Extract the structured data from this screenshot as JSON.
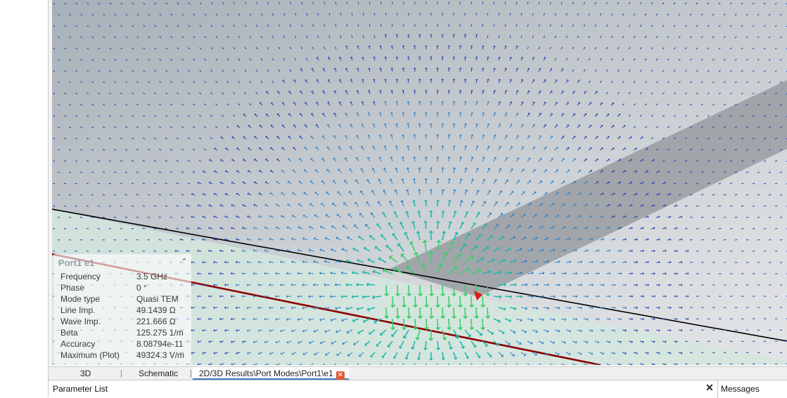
{
  "panel": {
    "title": "Port1 e1",
    "rows": [
      {
        "label": "Frequency",
        "value": "3.5 GHz"
      },
      {
        "label": "Phase",
        "value": "0 °"
      },
      {
        "label": "Mode type",
        "value": "Quasi TEM"
      },
      {
        "label": "Line Imp.",
        "value": "49.1439 Ω"
      },
      {
        "label": "Wave Imp.",
        "value": "221.666 Ω"
      },
      {
        "label": "Beta",
        "value": "125.275 1/m"
      },
      {
        "label": "Accuracy",
        "value": "8.08794e-11"
      },
      {
        "label": "Maximum (Plot)",
        "value": "49324.3 V/m"
      }
    ]
  },
  "tabs": {
    "tab_3d": "3D",
    "tab_schematic": "Schematic",
    "tab_results": "2D/3D Results\\Port Modes\\Port1\\e1"
  },
  "bottom": {
    "parameter_list": "Parameter List",
    "close_glyph": "✕",
    "messages": "Messages"
  },
  "icons": {
    "collapse": "chevron-up-icon",
    "tab_close": "close-icon"
  },
  "colors": {
    "arrow_far": "#1f3fb3",
    "arrow_mid": "#2a7fc8",
    "arrow_near": "#1fb8a8",
    "arrow_peak": "#3ccf6a",
    "arrow_max": "#e01818",
    "substrate_edge": "#8b0000",
    "tab_close_bg": "#e05a3a",
    "active_tab_underline": "#3b78c4"
  }
}
